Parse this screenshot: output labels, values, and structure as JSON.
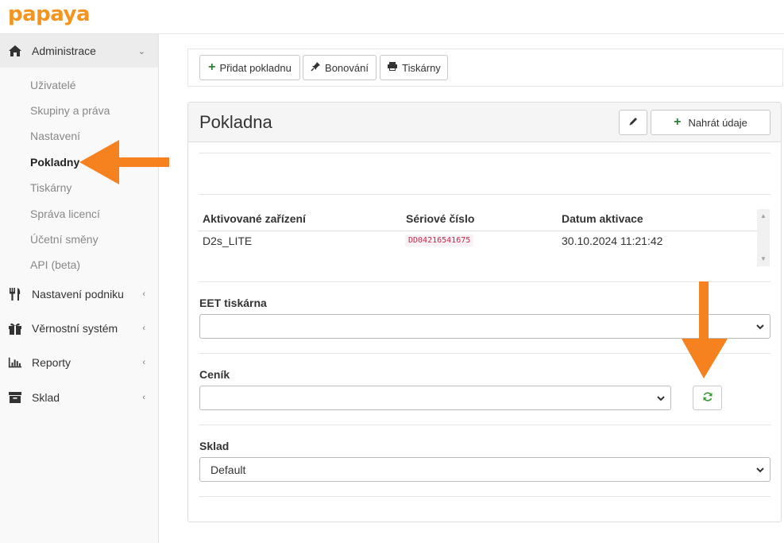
{
  "brand": {
    "logo_text": "papaya",
    "color": "#f5941e"
  },
  "sidebar": {
    "sections": [
      {
        "label": "Administrace",
        "icon": "home-icon",
        "expanded": true
      },
      {
        "label": "Nastavení podniku",
        "icon": "cutlery-icon"
      },
      {
        "label": "Věrnostní systém",
        "icon": "gift-icon"
      },
      {
        "label": "Reporty",
        "icon": "bar-chart-icon"
      },
      {
        "label": "Sklad",
        "icon": "archive-icon"
      }
    ],
    "admin_items": [
      {
        "label": "Uživatelé"
      },
      {
        "label": "Skupiny a práva"
      },
      {
        "label": "Nastavení"
      },
      {
        "label": "Pokladny",
        "current": true
      },
      {
        "label": "Tiskárny"
      },
      {
        "label": "Správa licencí"
      },
      {
        "label": "Účetní směny"
      },
      {
        "label": "API (beta)"
      }
    ]
  },
  "toolbar": {
    "add_register": "Přidat pokladnu",
    "bonovani": "Bonování",
    "printers": "Tiskárny"
  },
  "panel": {
    "title": "Pokladna",
    "upload_label": "Nahrát údaje"
  },
  "devices_table": {
    "headers": [
      "Aktivované zařízení",
      "Sériové číslo",
      "Datum aktivace"
    ],
    "rows": [
      {
        "device": "D2s_LITE",
        "serial": "DD04216541675",
        "date": "30.10.2024 11:21:42"
      }
    ]
  },
  "fields": {
    "eet_printer": {
      "label": "EET tiskárna",
      "value": ""
    },
    "price_list": {
      "label": "Ceník",
      "value": ""
    },
    "warehouse": {
      "label": "Sklad",
      "value": "Default"
    }
  },
  "colors": {
    "accent_arrow": "#f5821f",
    "refresh_green": "#3a9a3a",
    "serial_red": "#c7254e"
  }
}
